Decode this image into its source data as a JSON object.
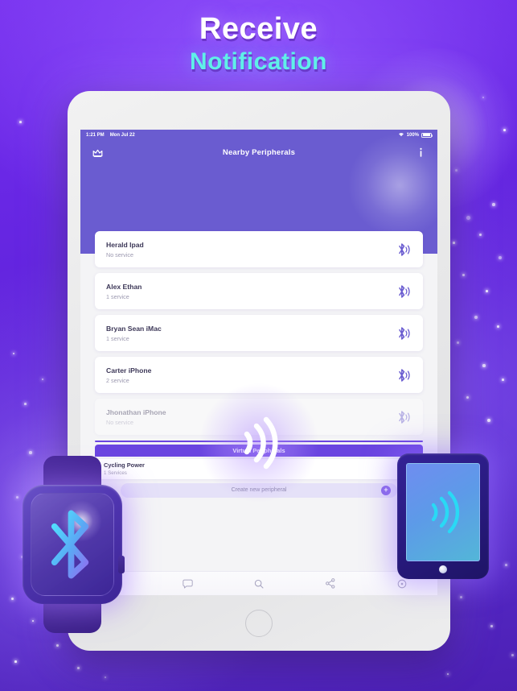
{
  "headline": {
    "line1": "Receive",
    "line2": "Notification",
    "line1_color": "#ffffff",
    "line2_color": "#5ff0e8"
  },
  "theme": {
    "background_purple": "#5b1fd4",
    "app_purple": "#6a5cd0",
    "accent_violet": "#6a45e0",
    "cyan": "#29d9f5"
  },
  "device": {
    "status_bar": {
      "time": "1:21 PM",
      "date": "Mon Jul 22",
      "battery_percent": "100%",
      "wifi_icon": "wifi-icon",
      "battery_icon": "battery-icon"
    },
    "app_bar": {
      "left_icon": "crown-icon",
      "title": "Nearby Peripherals",
      "right_icon": "info-icon"
    },
    "peripherals": [
      {
        "name": "Herald Ipad",
        "service": "No service",
        "icon": "bluetooth-signal-icon",
        "dim": false
      },
      {
        "name": "Alex Ethan",
        "service": "1 service",
        "icon": "bluetooth-signal-icon",
        "dim": false
      },
      {
        "name": "Bryan Sean iMac",
        "service": "1 service",
        "icon": "bluetooth-signal-icon",
        "dim": false
      },
      {
        "name": "Carter iPhone",
        "service": "2 service",
        "icon": "bluetooth-signal-icon",
        "dim": false
      },
      {
        "name": "Jhonathan iPhone",
        "service": "No service",
        "icon": "bluetooth-signal-icon",
        "dim": true
      }
    ],
    "virtual_section": {
      "header": "Virtual Peripherals",
      "item_name": "Cycling Power",
      "item_services": "1 Services",
      "toggle_icon": "toggle-dot-icon",
      "create_label": "Create new peripheral",
      "create_icon": "plus-circle-icon"
    },
    "tab_bar": [
      {
        "icon": "bluetooth-icon"
      },
      {
        "icon": "chat-icon"
      },
      {
        "icon": "search-icon"
      },
      {
        "icon": "share-icon"
      },
      {
        "icon": "settings-icon"
      }
    ],
    "center_graphic": "signal-waves-icon",
    "home_button": "home-button-icon"
  },
  "props": {
    "smartwatch": {
      "icon": "bluetooth-icon",
      "label": "smartwatch"
    },
    "tablet_small": {
      "icon": "signal-waves-icon",
      "label": "tablet"
    }
  }
}
